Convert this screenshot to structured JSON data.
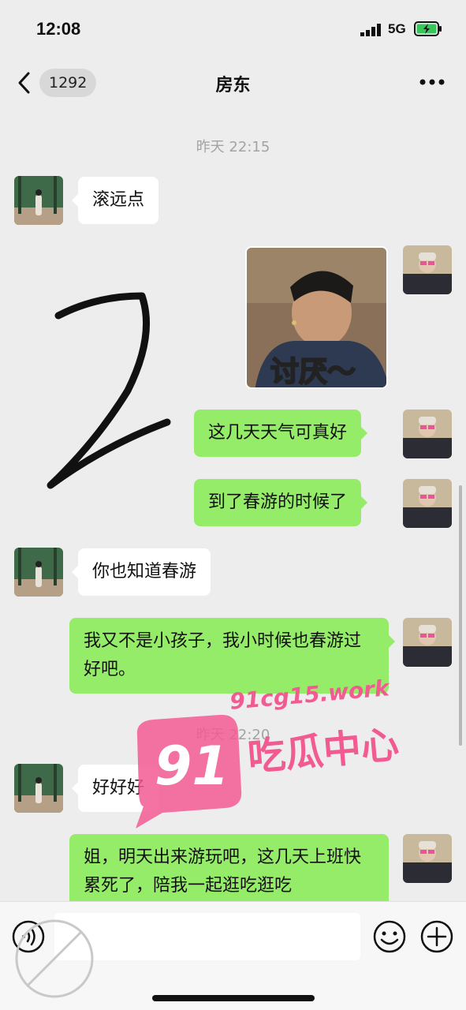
{
  "status_bar": {
    "time": "12:08",
    "network": "5G"
  },
  "header": {
    "unread_count": "1292",
    "title": "房东"
  },
  "timestamps": [
    "昨天 22:15",
    "昨天 22:20"
  ],
  "messages": [
    {
      "side": "left",
      "text": "滚远点"
    },
    {
      "side": "right",
      "type": "sticker",
      "text": "讨厌～"
    },
    {
      "side": "right",
      "text": "这几天天气可真好"
    },
    {
      "side": "right",
      "text": "到了春游的时候了"
    },
    {
      "side": "left",
      "text": "你也知道春游"
    },
    {
      "side": "right",
      "text": "我又不是小孩子，我小时候也春游过好吧。"
    },
    {
      "side": "left",
      "text": "好好好"
    },
    {
      "side": "right",
      "text": "姐，明天出来游玩吧，这几天上班快累死了，陪我一起逛吃逛吃"
    }
  ],
  "watermark": {
    "site": "91cg15.work",
    "brand_num": "91",
    "brand_text": "吃瓜中心"
  },
  "icons": [
    "back-chevron-icon",
    "more-icon",
    "voice-icon",
    "emoji-icon",
    "plus-icon",
    "signal-icon",
    "battery-icon"
  ]
}
